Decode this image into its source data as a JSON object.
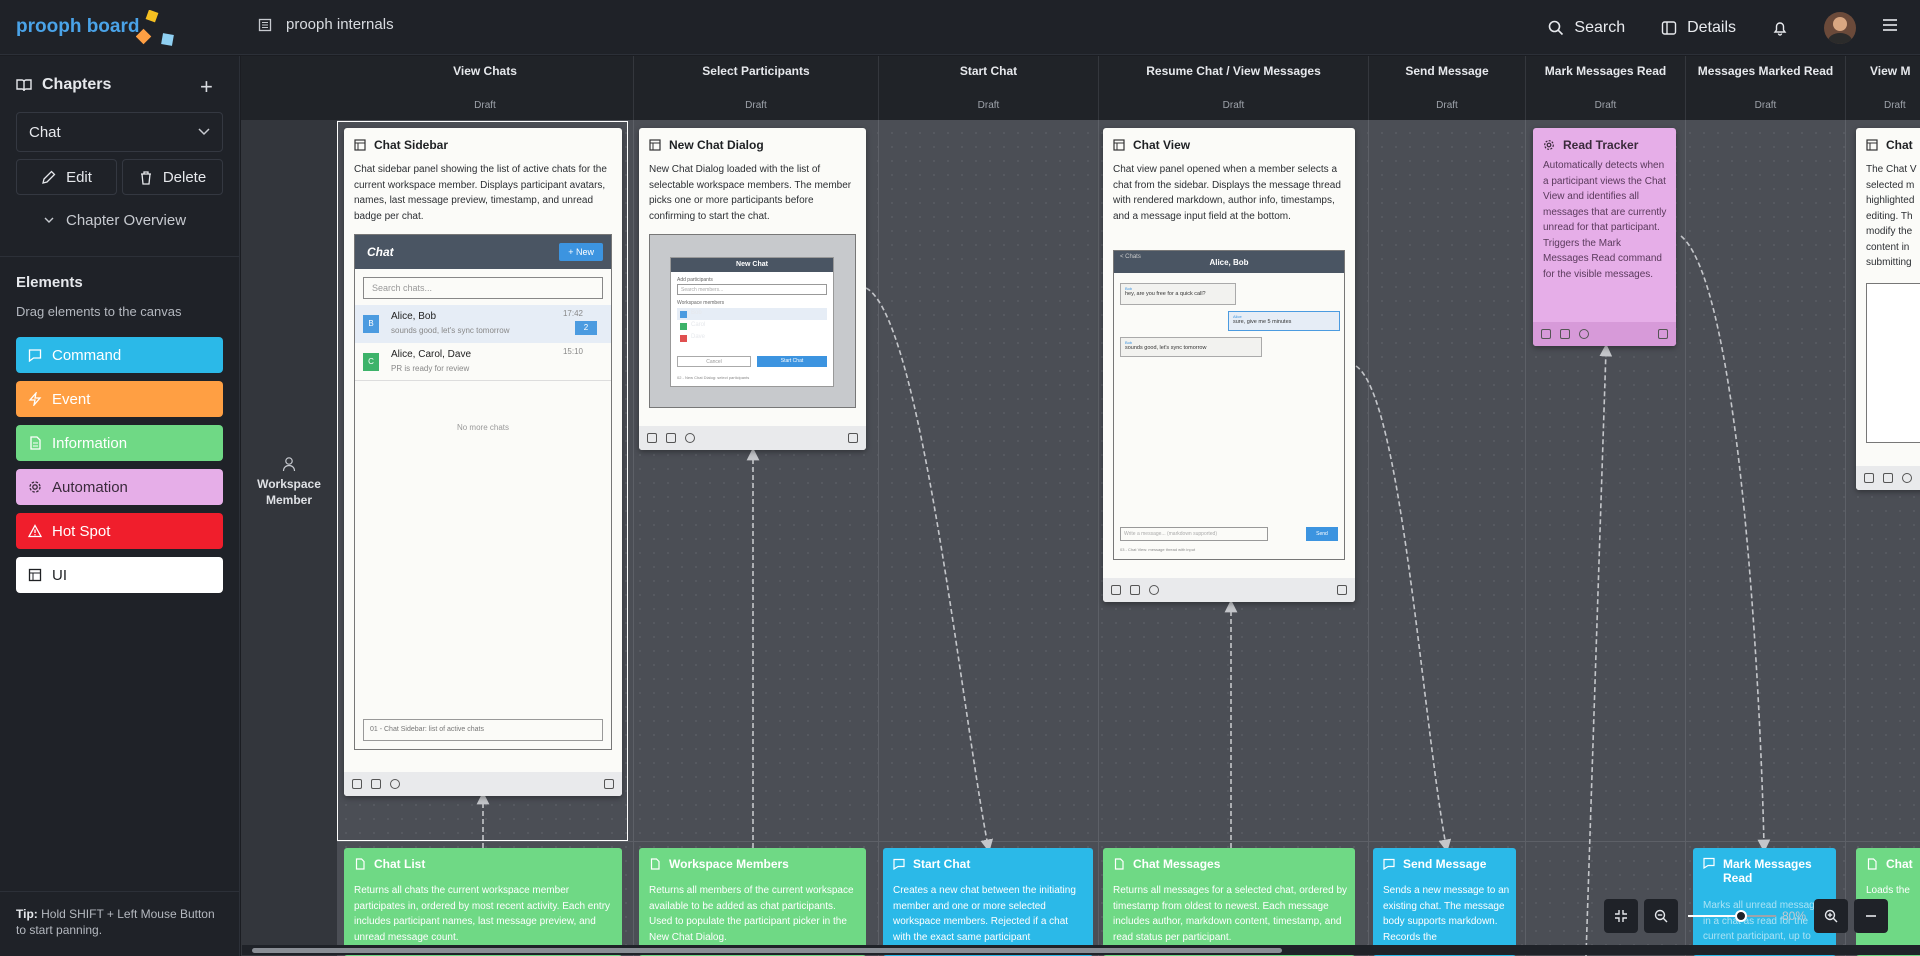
{
  "app": {
    "logo": "prooph board",
    "project": "prooph internals"
  },
  "topbar": {
    "search_label": "Search",
    "details_label": "Details"
  },
  "sidebar": {
    "chapters_title": "Chapters",
    "selected_chapter": "Chat",
    "edit_label": "Edit",
    "delete_label": "Delete",
    "overview_label": "Chapter Overview",
    "elements_title": "Elements",
    "elements_sub": "Drag elements to the canvas",
    "elements": [
      {
        "label": "Command",
        "color": "#2bb9e8"
      },
      {
        "label": "Event",
        "color": "#ff9f43"
      },
      {
        "label": "Information",
        "color": "#6fd985"
      },
      {
        "label": "Automation",
        "color": "#e6aee8"
      },
      {
        "label": "Hot Spot",
        "color": "#f01e2c"
      },
      {
        "label": "UI",
        "color": "#ffffff"
      }
    ],
    "tip_bold": "Tip:",
    "tip_text": "Hold SHIFT + Left Mouse Button to start panning."
  },
  "actor": {
    "name": "Workspace Member"
  },
  "lanes": [
    {
      "title": "View Chats",
      "status": "Draft"
    },
    {
      "title": "Select Participants",
      "status": "Draft"
    },
    {
      "title": "Start Chat",
      "status": "Draft"
    },
    {
      "title": "Resume Chat / View Messages",
      "status": "Draft"
    },
    {
      "title": "Send Message",
      "status": "Draft"
    },
    {
      "title": "Mark Messages Read",
      "status": "Draft"
    },
    {
      "title": "Messages Marked Read",
      "status": "Draft"
    },
    {
      "title": "View M",
      "status": "Draft"
    }
  ],
  "ui_cards": {
    "chat_sidebar": {
      "title": "Chat Sidebar",
      "text": "Chat sidebar panel showing the list of active chats for the current workspace member. Displays participant avatars, names, last message preview, timestamp, and unread badge per chat.",
      "mock": {
        "header": "Chat",
        "new_btn": "+ New",
        "search": "Search chats...",
        "items": [
          {
            "initial": "B",
            "name": "Alice, Bob",
            "preview": "sounds good, let's sync tomorrow",
            "time": "17:42",
            "badge": "2"
          },
          {
            "initial": "C",
            "name": "Alice, Carol, Dave",
            "preview": "PR is ready for review",
            "time": "15:10",
            "badge": ""
          }
        ],
        "empty": "No more chats",
        "caption": "01 - Chat Sidebar: list of active chats"
      }
    },
    "new_chat_dialog": {
      "title": "New Chat Dialog",
      "text": "New Chat Dialog loaded with the list of selectable workspace members. The member picks one or more participants before confirming to start the chat.",
      "mock": {
        "header": "New Chat",
        "field_label": "Add participants",
        "field_placeholder": "Search members...",
        "list_label": "Workspace members",
        "members": [
          "Bob",
          "Carol",
          "Dave"
        ],
        "cancel": "Cancel",
        "confirm": "Start Chat",
        "caption": "02 - New Chat Dialog: select participants"
      }
    },
    "chat_view": {
      "title": "Chat View",
      "text": "Chat view panel opened when a member selects a chat from the sidebar. Displays the message thread with rendered markdown, author info, timestamps, and a message input field at the bottom.",
      "mock": {
        "back": "< Chats",
        "header": "Alice, Bob",
        "messages": [
          {
            "author": "Bob",
            "text": "hey, are you free for a quick call?"
          },
          {
            "author": "Alice",
            "text": "sure, give me 5 minutes"
          },
          {
            "author": "Bob",
            "text": "sounds good, let's sync tomorrow"
          }
        ],
        "input": "Write a message... (markdown supported)",
        "send": "Send",
        "caption": "03 - Chat View: message thread with input"
      }
    },
    "chat_partial": {
      "title": "Chat",
      "text": "The Chat V selected m highlighted editing. Th modify the content in submitting"
    }
  },
  "automation": {
    "title": "Read Tracker",
    "text": "Automatically detects when a participant views the Chat View and identifies all messages that are currently unread for that participant. Triggers the Mark Messages Read command for the visible messages."
  },
  "bottom_cards": [
    {
      "kind": "information",
      "title": "Chat List",
      "text": "Returns all chats the current workspace member participates in, ordered by most recent activity. Each entry includes participant names, last message preview, and unread message count."
    },
    {
      "kind": "information",
      "title": "Workspace Members",
      "text": "Returns all members of the current workspace available to be added as chat participants. Used to populate the participant picker in the New Chat Dialog."
    },
    {
      "kind": "command",
      "title": "Start Chat",
      "text": "Creates a new chat between the initiating member and one or more selected workspace members. Rejected if a chat with the exact same participant"
    },
    {
      "kind": "information",
      "title": "Chat Messages",
      "text": "Returns all messages for a selected chat, ordered by timestamp from oldest to newest. Each message includes author, markdown content, timestamp, and read status per participant."
    },
    {
      "kind": "command",
      "title": "Send Message",
      "text": "Sends a new message to an existing chat. The message body supports markdown. Records the"
    },
    {
      "kind": "command",
      "title": "Mark Messages Read",
      "text": "Marks all unread messages in a chat as read for the current participant, up to"
    },
    {
      "kind": "information",
      "title": "Chat",
      "text": "Loads the"
    }
  ],
  "zoom": {
    "value": "80%",
    "level": 0.8
  }
}
